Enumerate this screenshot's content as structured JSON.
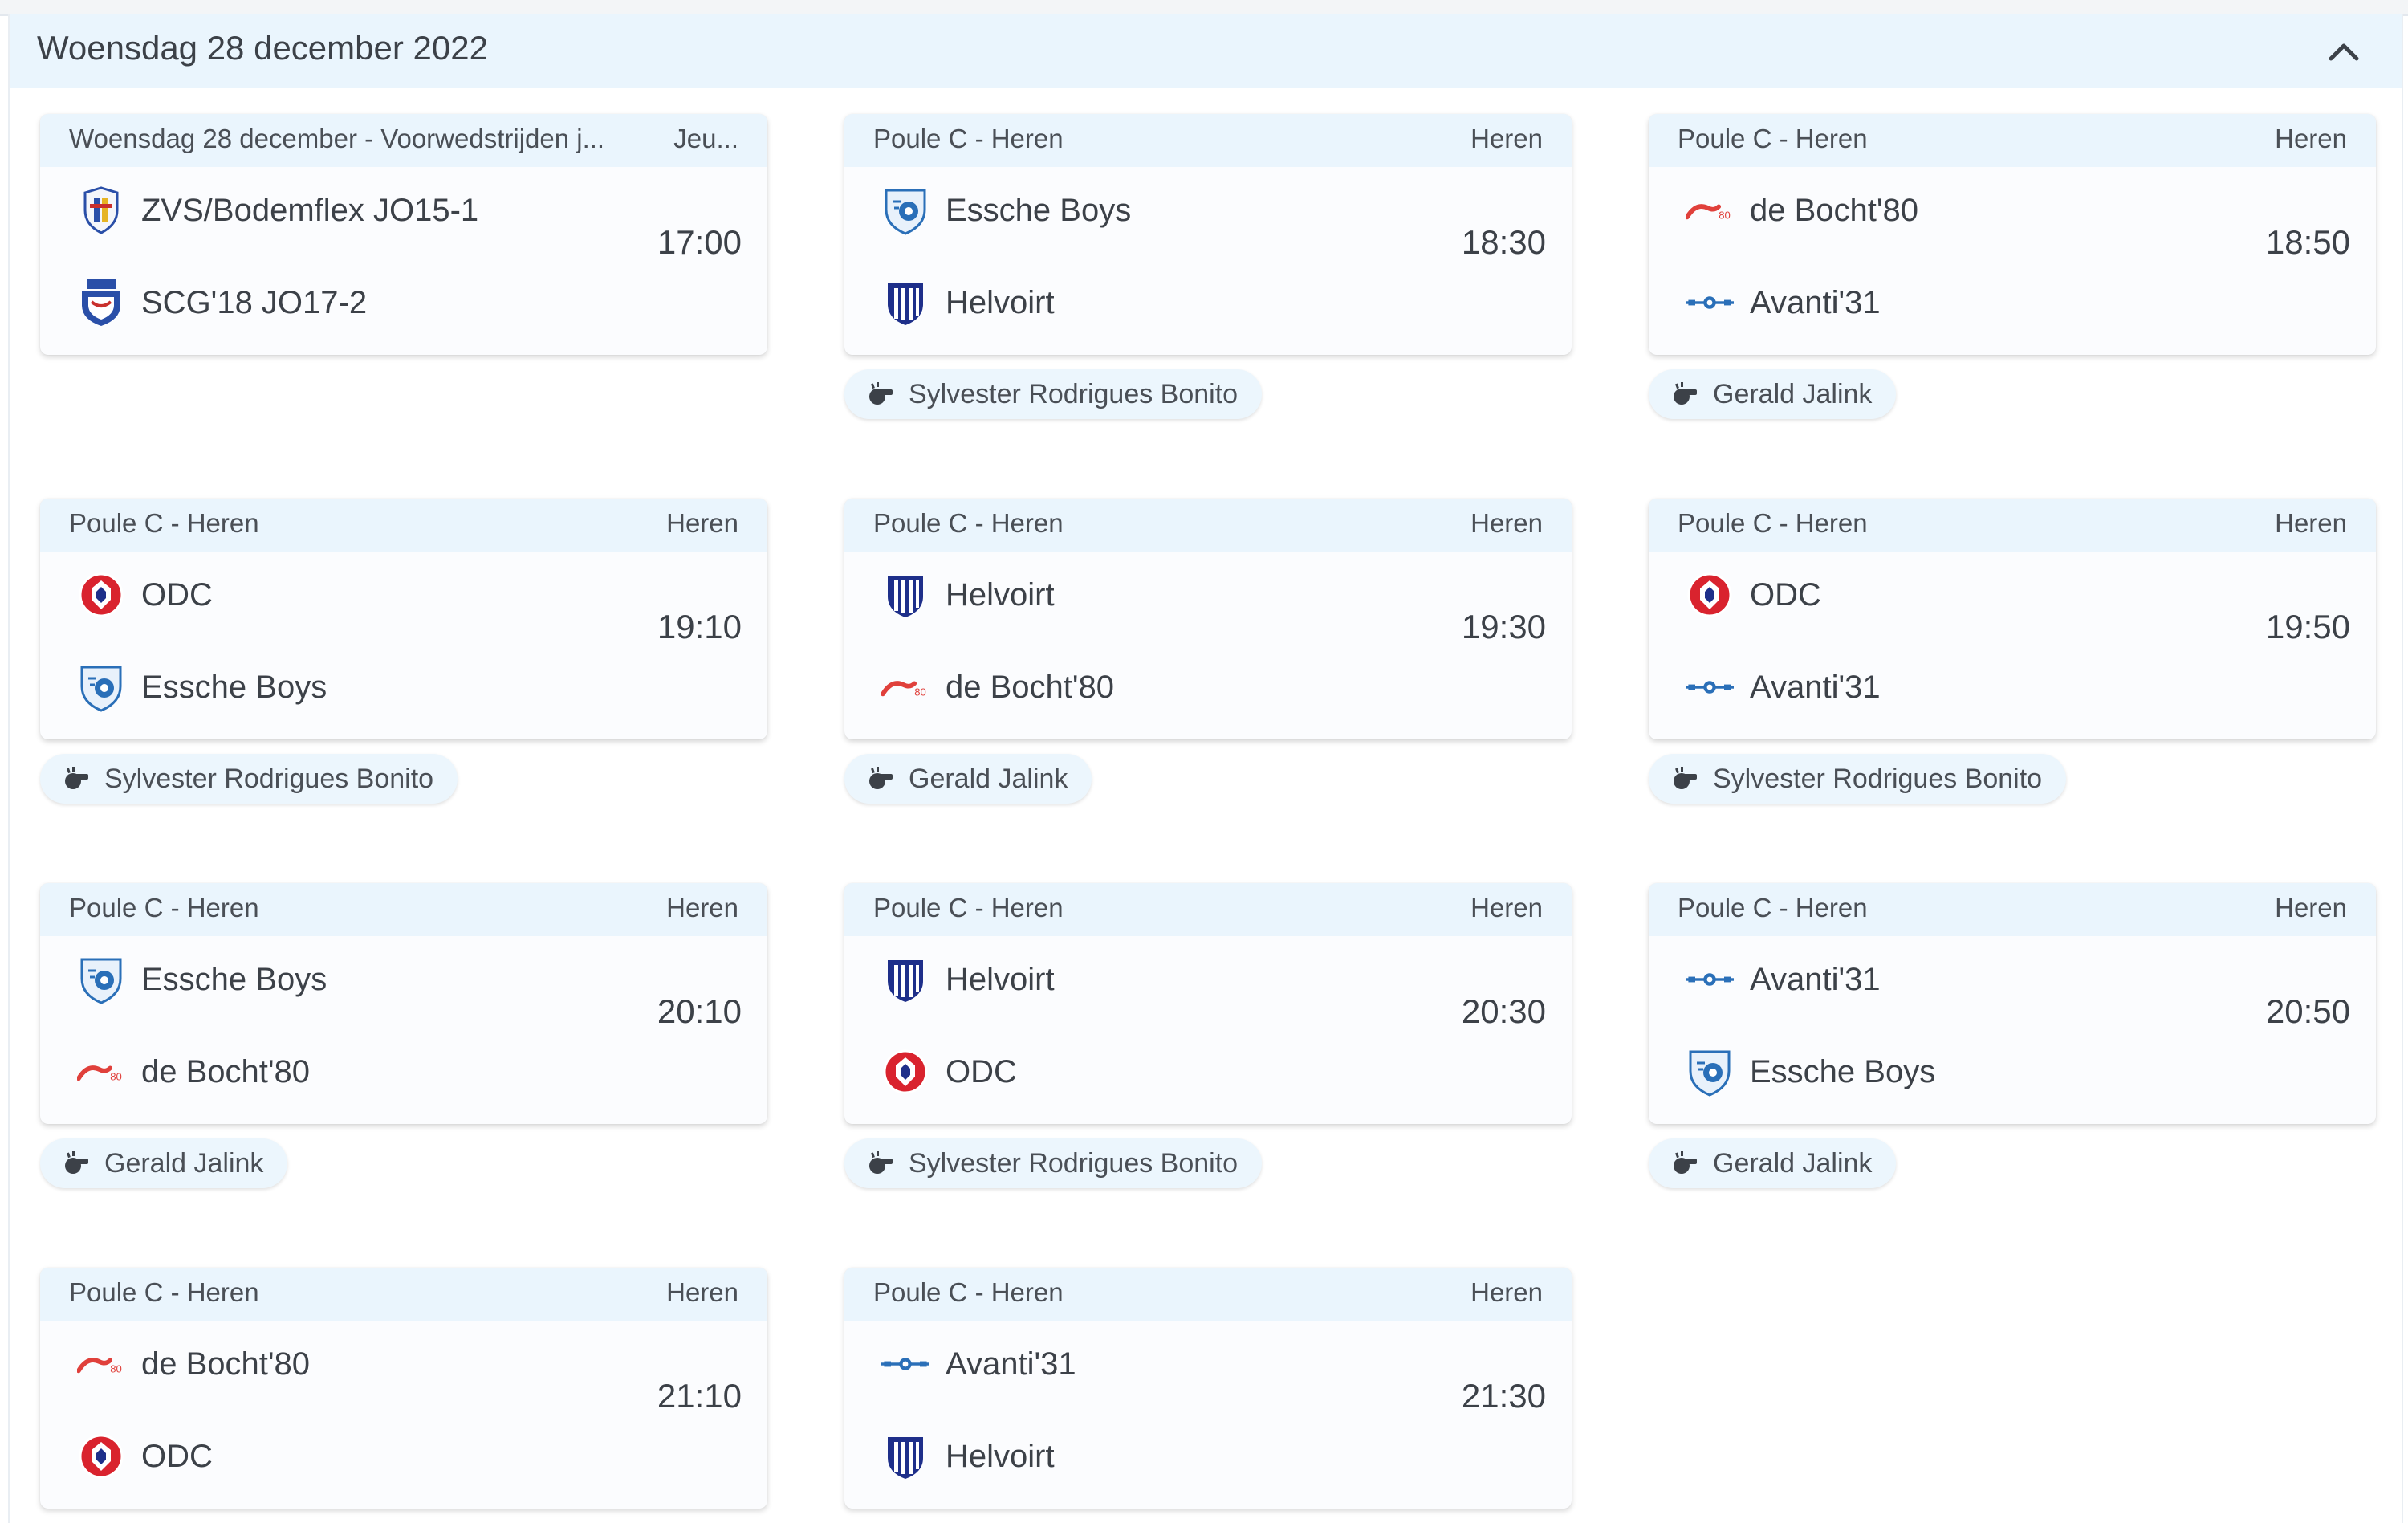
{
  "day": {
    "title": "Woensdag 28 december 2022"
  },
  "colors": {
    "header_bg": "#eaf5fd",
    "text": "#3c4148",
    "odc_red": "#d9232e",
    "club_blue": "#2a4fa8"
  },
  "matches": [
    {
      "competition": "Woensdag 28 december - Voorwedstrijden j...",
      "category": "Jeu...",
      "home": "ZVS/Bodemflex JO15-1",
      "away": "SCG'18 JO17-2",
      "home_logo": "shield-crest-icon",
      "away_logo": "scg-crest-icon",
      "time": "17:00",
      "referee": ""
    },
    {
      "competition": "Poule C - Heren",
      "category": "Heren",
      "home": "Essche Boys",
      "away": "Helvoirt",
      "home_logo": "essche-boys-logo",
      "away_logo": "helvoirt-logo",
      "time": "18:30",
      "referee": "Sylvester Rodrigues Bonito"
    },
    {
      "competition": "Poule C - Heren",
      "category": "Heren",
      "home": "de Bocht'80",
      "away": "Avanti'31",
      "home_logo": "bocht80-logo",
      "away_logo": "avanti31-logo",
      "time": "18:50",
      "referee": "Gerald Jalink"
    },
    {
      "competition": "Poule C - Heren",
      "category": "Heren",
      "home": "ODC",
      "away": "Essche Boys",
      "home_logo": "odc-logo",
      "away_logo": "essche-boys-logo",
      "time": "19:10",
      "referee": "Sylvester Rodrigues Bonito"
    },
    {
      "competition": "Poule C - Heren",
      "category": "Heren",
      "home": "Helvoirt",
      "away": "de Bocht'80",
      "home_logo": "helvoirt-logo",
      "away_logo": "bocht80-logo",
      "time": "19:30",
      "referee": "Gerald Jalink"
    },
    {
      "competition": "Poule C - Heren",
      "category": "Heren",
      "home": "ODC",
      "away": "Avanti'31",
      "home_logo": "odc-logo",
      "away_logo": "avanti31-logo",
      "time": "19:50",
      "referee": "Sylvester Rodrigues Bonito"
    },
    {
      "competition": "Poule C - Heren",
      "category": "Heren",
      "home": "Essche Boys",
      "away": "de Bocht'80",
      "home_logo": "essche-boys-logo",
      "away_logo": "bocht80-logo",
      "time": "20:10",
      "referee": "Gerald Jalink"
    },
    {
      "competition": "Poule C - Heren",
      "category": "Heren",
      "home": "Helvoirt",
      "away": "ODC",
      "home_logo": "helvoirt-logo",
      "away_logo": "odc-logo",
      "time": "20:30",
      "referee": "Sylvester Rodrigues Bonito"
    },
    {
      "competition": "Poule C - Heren",
      "category": "Heren",
      "home": "Avanti'31",
      "away": "Essche Boys",
      "home_logo": "avanti31-logo",
      "away_logo": "essche-boys-logo",
      "time": "20:50",
      "referee": "Gerald Jalink"
    },
    {
      "competition": "Poule C - Heren",
      "category": "Heren",
      "home": "de Bocht'80",
      "away": "ODC",
      "home_logo": "bocht80-logo",
      "away_logo": "odc-logo",
      "time": "21:10",
      "referee": ""
    },
    {
      "competition": "Poule C - Heren",
      "category": "Heren",
      "home": "Avanti'31",
      "away": "Helvoirt",
      "home_logo": "avanti31-logo",
      "away_logo": "helvoirt-logo",
      "time": "21:30",
      "referee": ""
    }
  ]
}
